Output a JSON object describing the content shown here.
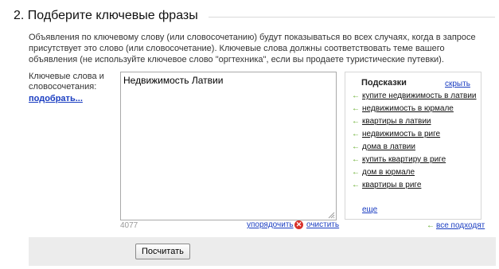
{
  "section": {
    "title": "2. Подберите ключевые фразы",
    "description": "Объявления по ключевому слову (или словосочетанию) будут показываться во всех случаях, когда в запросе присутствует это слово (или словосочетание). Ключевые слова должны соответствовать теме вашего объявления (не используйте ключевое слово \"оргтехника\", если вы продаете туристические путевки)."
  },
  "keywords": {
    "label": "Ключевые слова и словосочетания:",
    "pick_link": "подобрать...",
    "value": "Недвижимость Латвии",
    "chars_left": "4077",
    "sort_link": "упорядочить",
    "clear_link": "очистить"
  },
  "hints": {
    "title": "Подсказки",
    "hide_link": "скрыть",
    "items": [
      {
        "label": "купите недвижимость в латвии"
      },
      {
        "label": "недвижимость в юрмале"
      },
      {
        "label": "квартиры в латвии"
      },
      {
        "label": "недвижимость в риге"
      },
      {
        "label": "дома в латвии"
      },
      {
        "label": "купить квартиру в риге"
      },
      {
        "label": "дом в юрмале"
      },
      {
        "label": "квартиры в риге"
      }
    ],
    "more_link": "еще",
    "all_fit_link": "все подходят"
  },
  "actions": {
    "calculate_label": "Посчитать"
  },
  "colors": {
    "link": "#1a3dc1",
    "hint_arrow": "#5ca820",
    "clear_icon": "#d8312a",
    "footer_bg": "#ececec"
  },
  "icons": {
    "hint_arrow": "arrow-left-icon",
    "clear": "close-circle-icon",
    "resize": "resize-grip-icon"
  }
}
